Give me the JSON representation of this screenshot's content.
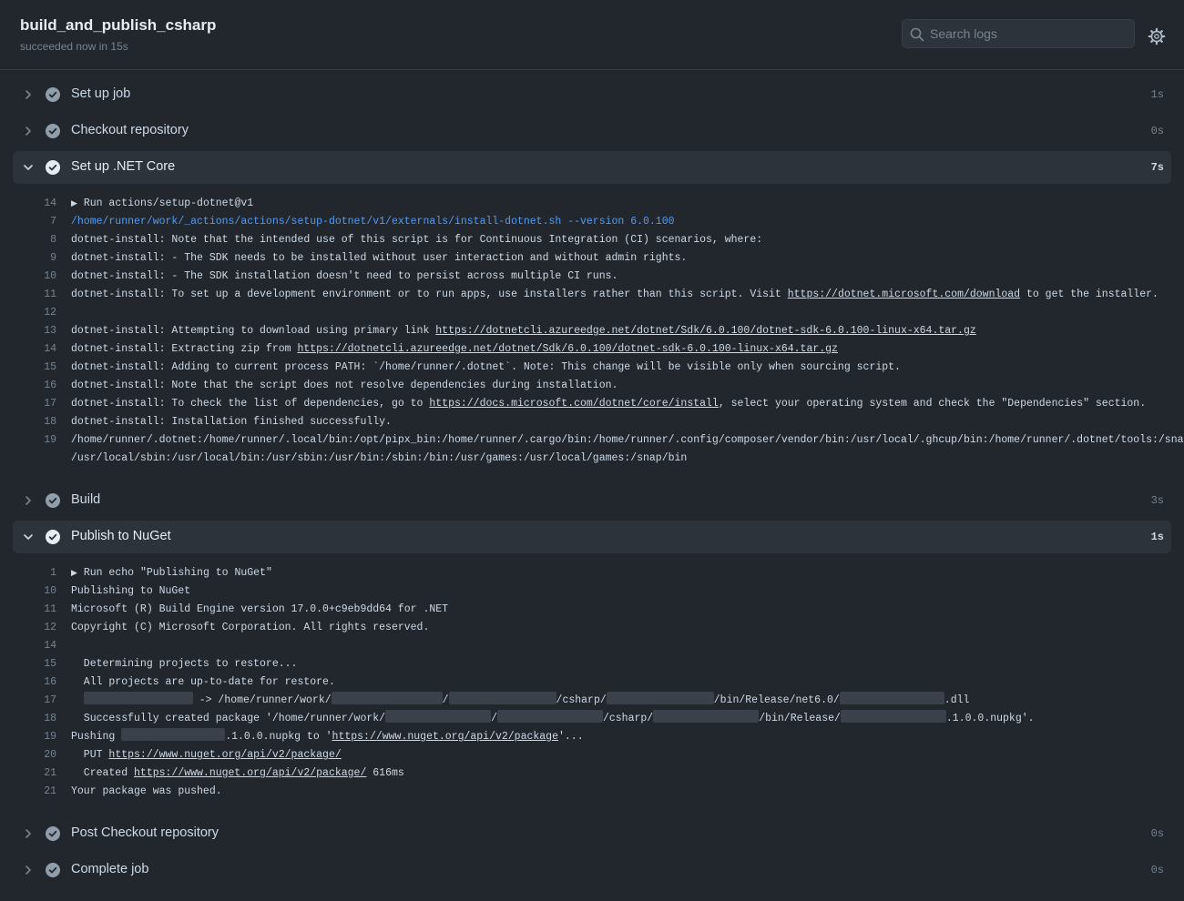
{
  "job": {
    "title": "build_and_publish_csharp",
    "status": "succeeded now in 15s"
  },
  "search": {
    "placeholder": "Search logs"
  },
  "steps": [
    {
      "name": "Set up job",
      "duration": "1s"
    },
    {
      "name": "Checkout repository",
      "duration": "0s"
    },
    {
      "name": "Set up .NET Core",
      "duration": "7s"
    },
    {
      "name": "Build",
      "duration": "3s"
    },
    {
      "name": "Publish to NuGet",
      "duration": "1s"
    },
    {
      "name": "Post Checkout repository",
      "duration": "0s"
    },
    {
      "name": "Complete job",
      "duration": "0s"
    }
  ],
  "dotnet_log": [
    {
      "n": "14",
      "run": "Run actions/setup-dotnet@v1"
    },
    {
      "n": "7",
      "cmd": "/home/runner/work/_actions/actions/setup-dotnet/v1/externals/install-dotnet.sh --version 6.0.100"
    },
    {
      "n": "8",
      "t": "dotnet-install: Note that the intended use of this script is for Continuous Integration (CI) scenarios, where:"
    },
    {
      "n": "9",
      "t": "dotnet-install: - The SDK needs to be installed without user interaction and without admin rights."
    },
    {
      "n": "10",
      "t": "dotnet-install: - The SDK installation doesn't need to persist across multiple CI runs."
    },
    {
      "n": "11",
      "t": "dotnet-install: To set up a development environment or to run apps, use installers rather than this script. Visit ",
      "u": "https://dotnet.microsoft.com/download",
      "t2": " to get the installer."
    },
    {
      "n": "12",
      "t": ""
    },
    {
      "n": "13",
      "t": "dotnet-install: Attempting to download using primary link ",
      "u": "https://dotnetcli.azureedge.net/dotnet/Sdk/6.0.100/dotnet-sdk-6.0.100-linux-x64.tar.gz"
    },
    {
      "n": "14",
      "t": "dotnet-install: Extracting zip from ",
      "u": "https://dotnetcli.azureedge.net/dotnet/Sdk/6.0.100/dotnet-sdk-6.0.100-linux-x64.tar.gz"
    },
    {
      "n": "15",
      "t": "dotnet-install: Adding to current process PATH: `/home/runner/.dotnet`. Note: This change will be visible only when sourcing script."
    },
    {
      "n": "16",
      "t": "dotnet-install: Note that the script does not resolve dependencies during installation."
    },
    {
      "n": "17",
      "t": "dotnet-install: To check the list of dependencies, go to ",
      "u": "https://docs.microsoft.com/dotnet/core/install",
      "t2": ", select your operating system and check the \"Dependencies\" section."
    },
    {
      "n": "18",
      "t": "dotnet-install: Installation finished successfully."
    },
    {
      "n": "19",
      "t": "/home/runner/.dotnet:/home/runner/.local/bin:/opt/pipx_bin:/home/runner/.cargo/bin:/home/runner/.config/composer/vendor/bin:/usr/local/.ghcup/bin:/home/runner/.dotnet/tools:/snap/bin:"
    },
    {
      "n": "",
      "t": "/usr/local/sbin:/usr/local/bin:/usr/sbin:/usr/bin:/sbin:/bin:/usr/games:/usr/local/games:/snap/bin"
    }
  ],
  "publish_log": {
    "l1": {
      "n": "1",
      "run": "Run echo \"Publishing to NuGet\""
    },
    "l2": {
      "n": "10",
      "t": "Publishing to NuGet"
    },
    "l3": {
      "n": "11",
      "t": "Microsoft (R) Build Engine version 17.0.0+c9eb9dd64 for .NET"
    },
    "l4": {
      "n": "12",
      "t": "Copyright (C) Microsoft Corporation. All rights reserved."
    },
    "l5": {
      "n": "14",
      "t": ""
    },
    "l6": {
      "n": "15",
      "t": "  Determining projects to restore..."
    },
    "l7": {
      "n": "16",
      "t": "  All projects are up-to-date for restore."
    },
    "l8": {
      "n": "17",
      "a": " -> /home/runner/work/",
      "b": "/",
      "c": "/csharp/",
      "d": "/bin/Release/net6.0/",
      "e": ".dll"
    },
    "l9": {
      "n": "18",
      "a": "  Successfully created package '/home/runner/work/",
      "b": "/",
      "c": "/csharp/",
      "d": "/bin/Release/",
      "e": ".1.0.0.nupkg'."
    },
    "l10": {
      "n": "19",
      "a": "Pushing ",
      "b": ".1.0.0.nupkg to '",
      "u": "https://www.nuget.org/api/v2/package",
      "c": "'..."
    },
    "l11": {
      "n": "20",
      "a": "  PUT ",
      "u": "https://www.nuget.org/api/v2/package/"
    },
    "l12": {
      "n": "21",
      "a": "  Created ",
      "u": "https://www.nuget.org/api/v2/package/",
      "b": " 616ms"
    },
    "l13": {
      "n": "21",
      "t": "Your package was pushed."
    }
  }
}
